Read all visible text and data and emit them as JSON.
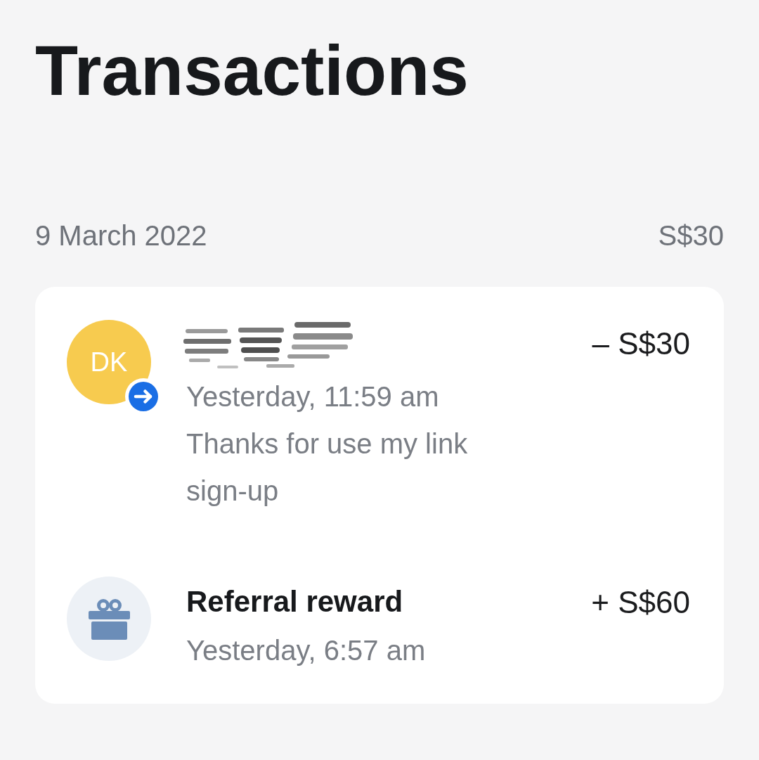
{
  "page_title": "Transactions",
  "groups": [
    {
      "date": "9 March 2022",
      "total": "S$30",
      "transactions": [
        {
          "kind": "person",
          "avatar_initials": "DK",
          "direction_badge": true,
          "name_redacted": true,
          "time": "Yesterday, 11:59 am",
          "note": "Thanks for use my link sign-up",
          "amount": "– S$30"
        },
        {
          "kind": "reward",
          "title": "Referral reward",
          "time": "Yesterday, 6:57 am",
          "amount": "+ S$60"
        }
      ]
    }
  ]
}
